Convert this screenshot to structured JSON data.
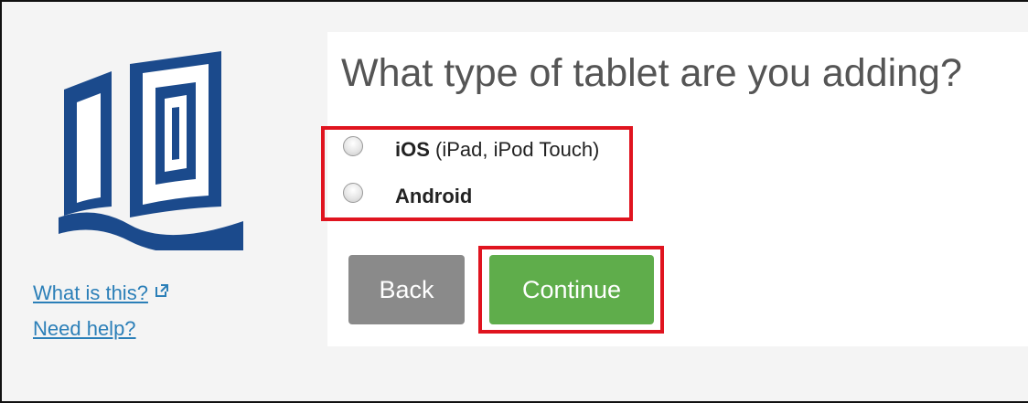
{
  "colors": {
    "brand_blue": "#1b4a8c",
    "link_blue": "#2b7fb8",
    "highlight_red": "#e0141f",
    "continue_green": "#5fad4b",
    "back_gray": "#8a8a8a"
  },
  "sidebar": {
    "what_is_this": "What is this?",
    "need_help": "Need help?"
  },
  "main": {
    "title": "What type of tablet are you adding?",
    "options": [
      {
        "label_bold": "iOS",
        "label_detail": " (iPad, iPod Touch)",
        "selected": false
      },
      {
        "label_bold": "Android",
        "label_detail": "",
        "selected": false
      }
    ],
    "back_label": "Back",
    "continue_label": "Continue"
  },
  "icons": {
    "logo": "book-logo-icon",
    "external_link": "external-link-icon",
    "radio": "radio-unchecked-icon"
  }
}
